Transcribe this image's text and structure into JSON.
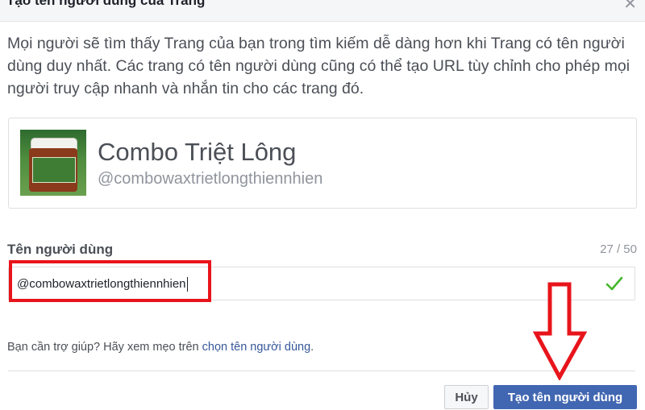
{
  "dialog": {
    "title": "Tạo tên người dùng của Trang",
    "description": "Mọi người sẽ tìm thấy Trang của bạn trong tìm kiếm dễ dàng hơn khi Trang có tên người dùng duy nhất. Các trang có tên người dùng cũng có thể tạo URL tùy chỉnh cho phép mọi người truy cập nhanh và nhắn tin cho các trang đó."
  },
  "page_card": {
    "name": "Combo Triệt Lông",
    "handle": "@combowaxtrietlongthiennhien"
  },
  "username_field": {
    "label": "Tên người dùng",
    "counter": "27 / 50",
    "value": "@combowaxtrietlongthiennhien",
    "valid_icon": "checkmark-icon"
  },
  "help": {
    "text": "Bạn cần trợ giúp? Hãy xem mẹo trên ",
    "link": "chọn tên người dùng",
    "suffix": "."
  },
  "buttons": {
    "cancel": "Hủy",
    "create": "Tạo tên người dùng"
  },
  "annotation": {
    "highlight_color": "#e8141b",
    "arrow_color": "#e8141b"
  },
  "colors": {
    "primary": "#4267b2",
    "link": "#365899",
    "valid": "#42b72a"
  }
}
